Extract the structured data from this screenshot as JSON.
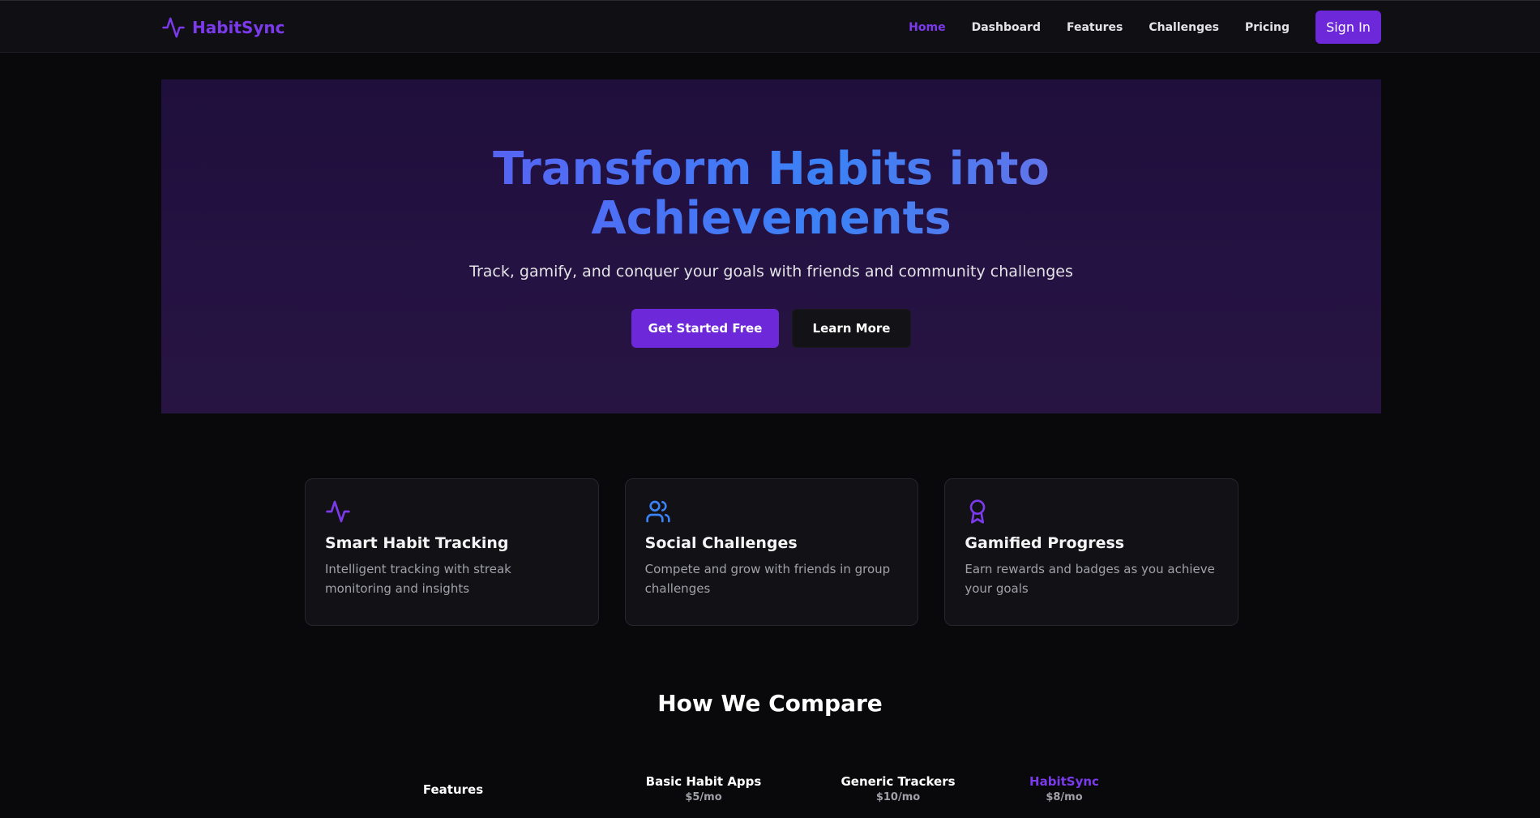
{
  "navbar": {
    "brand": "HabitSync",
    "links": [
      {
        "label": "Home",
        "active": true
      },
      {
        "label": "Dashboard"
      },
      {
        "label": "Features"
      },
      {
        "label": "Challenges"
      },
      {
        "label": "Pricing"
      }
    ],
    "signin_label": "Sign In"
  },
  "hero": {
    "title_line1": "Transform Habits into",
    "title_line2": "Achievements",
    "subtitle": "Track, gamify, and conquer your goals with friends and community challenges",
    "primary_cta": "Get Started Free",
    "secondary_cta": "Learn More"
  },
  "features": [
    {
      "icon": "activity-icon",
      "title": "Smart Habit Tracking",
      "description": "Intelligent tracking with streak monitoring and insights",
      "icon_color": "#7c3aed"
    },
    {
      "icon": "users-icon",
      "title": "Social Challenges",
      "description": "Compete and grow with friends in group challenges",
      "icon_color": "#3b82f6"
    },
    {
      "icon": "award-icon",
      "title": "Gamified Progress",
      "description": "Earn rewards and badges as you achieve your goals",
      "icon_color": "#7c3aed"
    }
  ],
  "compare": {
    "title": "How We Compare",
    "features_label": "Features",
    "columns": [
      {
        "name": "Basic Habit Apps",
        "price": "$5/mo"
      },
      {
        "name": "Generic Trackers",
        "price": "$10/mo"
      },
      {
        "name": "HabitSync",
        "price": "$8/mo"
      }
    ]
  },
  "colors": {
    "accent": "#7c3aed",
    "button": "#6d28d9",
    "blue": "#3b82f6",
    "background": "#09090b"
  }
}
